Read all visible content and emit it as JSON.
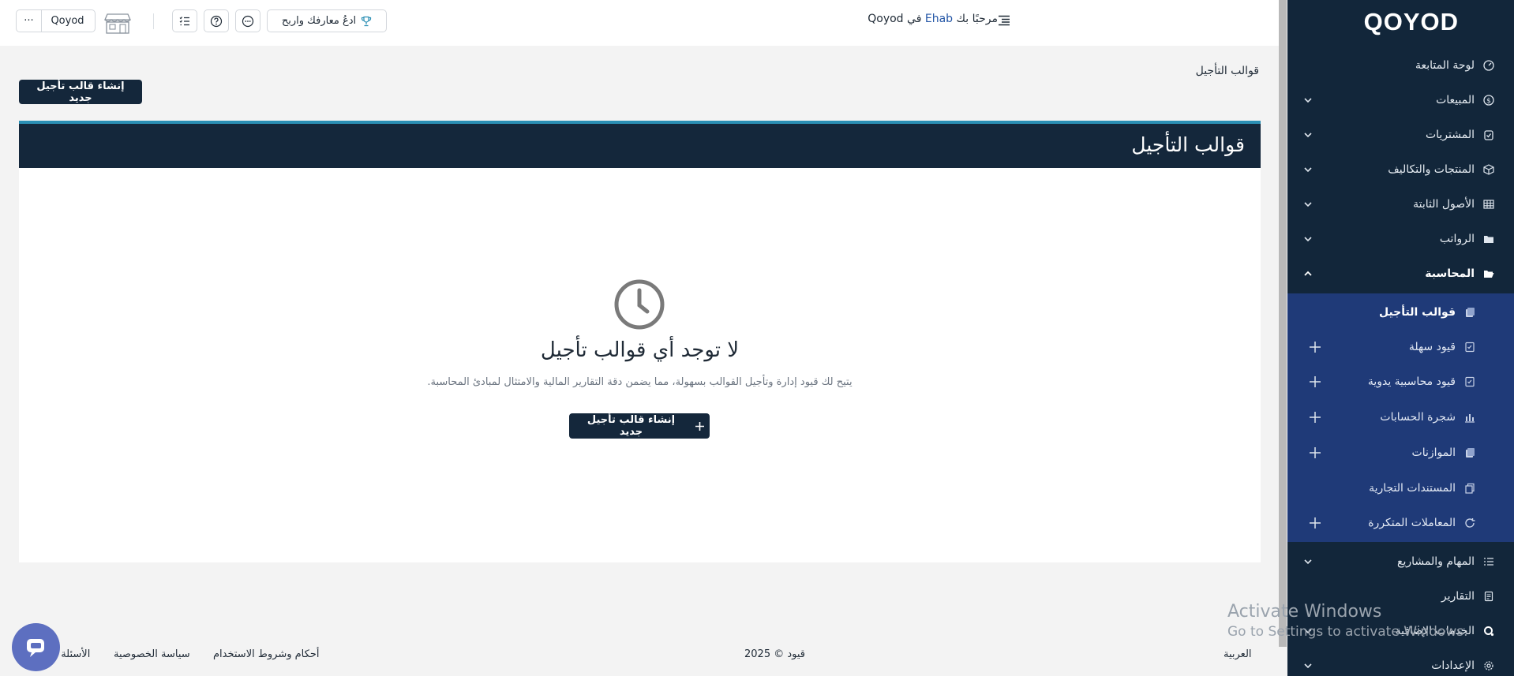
{
  "sidebar": {
    "logo": "QOYOD",
    "items": [
      {
        "label": "لوحة المتابعة",
        "icon": "dashboard-icon",
        "has_chevron": false
      },
      {
        "label": "المبيعات",
        "icon": "dollar-icon",
        "has_chevron": true
      },
      {
        "label": "المشتريات",
        "icon": "purchases-icon",
        "has_chevron": true
      },
      {
        "label": "المنتجات والتكاليف",
        "icon": "box-icon",
        "has_chevron": true
      },
      {
        "label": "الأصول الثابتة",
        "icon": "grid-icon",
        "has_chevron": true
      },
      {
        "label": "الرواتب",
        "icon": "folder-icon",
        "has_chevron": true
      },
      {
        "label": "المحاسبة",
        "icon": "folder-open-icon",
        "has_chevron": true,
        "expanded": true
      }
    ],
    "submenu": [
      {
        "label": "قوالب التأجيل",
        "icon": "stack-icon",
        "active": true,
        "plus": false
      },
      {
        "label": "قيود سهلة",
        "icon": "journal-icon",
        "plus": true
      },
      {
        "label": "قيود محاسبية يدوية",
        "icon": "journal-icon",
        "plus": true
      },
      {
        "label": "شجرة الحسابات",
        "icon": "chart-bars-icon",
        "plus": true
      },
      {
        "label": "الموازنات",
        "icon": "stack-icon",
        "plus": true
      },
      {
        "label": "المستندات التجارية",
        "icon": "copy-icon",
        "plus": false
      },
      {
        "label": "المعاملات المتكررة",
        "icon": "refresh-icon",
        "plus": true
      }
    ],
    "items_after": [
      {
        "label": "المهام والمشاريع",
        "icon": "tasks-icon",
        "has_chevron": true
      },
      {
        "label": "التقارير",
        "icon": "report-icon",
        "has_chevron": false
      },
      {
        "label": "الخدمات الإضافية",
        "icon": "qoyod-icon",
        "has_chevron": true
      },
      {
        "label": "الإعدادات",
        "icon": "gear-icon",
        "has_chevron": true
      }
    ]
  },
  "topbar": {
    "welcome_prefix": "مرحبًا بك",
    "user": "Ehab",
    "welcome_suffix": "في Qoyod",
    "refer_label": "ادعُ معارفك واربح",
    "company_name": "Qoyod",
    "more_label": "···"
  },
  "content": {
    "breadcrumb": "قوالب التأجيل",
    "create_button": "إنشاء قالب تأجيل جديد",
    "panel_title": "قوالب التأجيل",
    "empty_title": "لا توجد أي قوالب تأجيل",
    "empty_desc": "يتيح لك قيود إدارة وتأجيل القوالب بسهولة، مما يضمن دقة التقارير المالية والامتثال لمبادئ المحاسبة.",
    "empty_button": "إنشاء قالب تأجيل جديد"
  },
  "footer": {
    "language": "العربية",
    "copyright": "قيود © 2025",
    "terms": "أحكام وشروط الاستخدام",
    "privacy": "سياسة الخصوصية",
    "faq": "الأسئلة ال"
  },
  "watermark": {
    "title": "Activate Windows",
    "subtitle": "Go to Settings to activate Windows."
  },
  "colors": {
    "sidebar_bg": "#12263a",
    "submenu_bg": "#1f3a78",
    "dark_button": "#14273b",
    "accent": "#2b8fb4",
    "page_bg": "#f3f3f3"
  }
}
